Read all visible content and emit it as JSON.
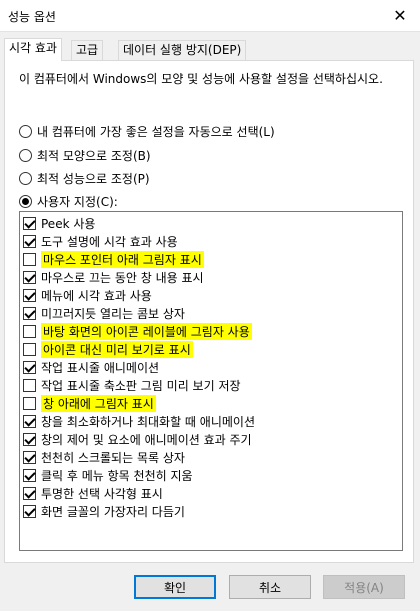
{
  "window": {
    "title": "성능 옵션"
  },
  "tabs": [
    {
      "label": "시각 효과"
    },
    {
      "label": "고급"
    },
    {
      "label": "데이터 실행 방지(DEP)"
    }
  ],
  "description": "이 컴퓨터에서 Windows의 모양 및 성능에 사용할 설정을 선택하십시오.",
  "radios": [
    {
      "label": "내 컴퓨터에 가장 좋은 설정을 자동으로 선택(L)",
      "checked": false
    },
    {
      "label": "최적 모양으로 조정(B)",
      "checked": false
    },
    {
      "label": "최적 성능으로 조정(P)",
      "checked": false
    },
    {
      "label": "사용자 지정(C):",
      "checked": true
    }
  ],
  "effects": [
    {
      "label": "Peek 사용",
      "checked": true,
      "highlighted": false
    },
    {
      "label": "도구 설명에 시각 효과 사용",
      "checked": true,
      "highlighted": false
    },
    {
      "label": "마우스 포인터 아래 그림자 표시",
      "checked": false,
      "highlighted": true
    },
    {
      "label": "마우스로 끄는 동안 창 내용 표시",
      "checked": true,
      "highlighted": false
    },
    {
      "label": "메뉴에 시각 효과 사용",
      "checked": true,
      "highlighted": false
    },
    {
      "label": "미끄러지듯 열리는 콤보 상자",
      "checked": true,
      "highlighted": false
    },
    {
      "label": "바탕 화면의 아이콘 레이블에 그림자 사용",
      "checked": false,
      "highlighted": true
    },
    {
      "label": "아이콘 대신 미리 보기로 표시",
      "checked": false,
      "highlighted": true
    },
    {
      "label": "작업 표시줄 애니메이션",
      "checked": true,
      "highlighted": false
    },
    {
      "label": "작업 표시줄 축소판 그림 미리 보기 저장",
      "checked": false,
      "highlighted": false
    },
    {
      "label": "창 아래에 그림자 표시",
      "checked": false,
      "highlighted": true
    },
    {
      "label": "창을 최소화하거나 최대화할 때 애니메이션",
      "checked": true,
      "highlighted": false
    },
    {
      "label": "창의 제어 및 요소에 애니메이션 효과 주기",
      "checked": true,
      "highlighted": false
    },
    {
      "label": "천천히 스크롤되는 목록 상자",
      "checked": true,
      "highlighted": false
    },
    {
      "label": "클릭 후 메뉴 항목 천천히 지움",
      "checked": true,
      "highlighted": false
    },
    {
      "label": "투명한 선택 사각형 표시",
      "checked": true,
      "highlighted": false
    },
    {
      "label": "화면 글꼴의 가장자리 다듬기",
      "checked": true,
      "highlighted": false
    }
  ],
  "buttons": {
    "ok": "확인",
    "cancel": "취소",
    "apply": "적용(A)"
  },
  "colors": {
    "highlight": "#ffff00",
    "accent": "#0078d7"
  }
}
